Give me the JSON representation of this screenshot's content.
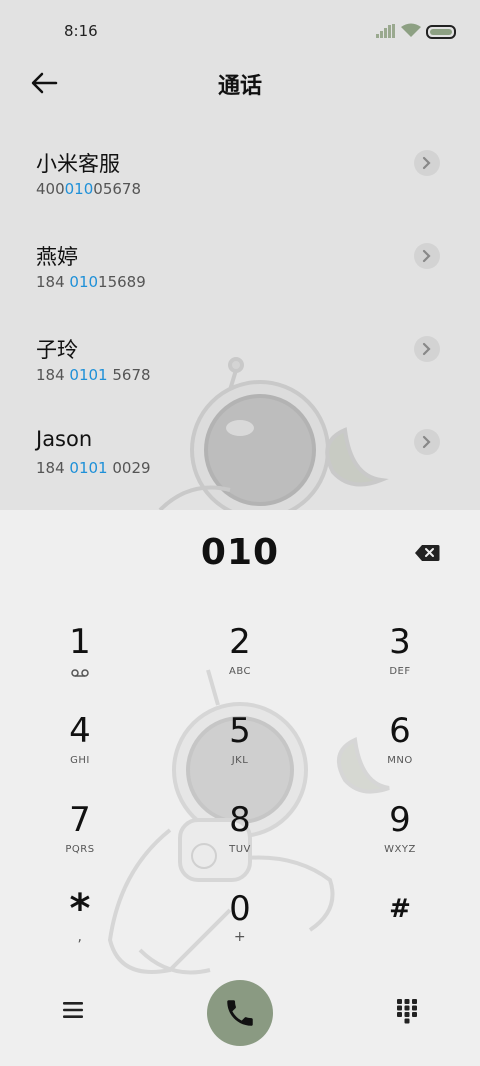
{
  "status": {
    "time": "8:16"
  },
  "header": {
    "title": "通话"
  },
  "contacts": [
    {
      "name": "小米客服",
      "num_pre": "400",
      "num_hl": "010",
      "num_post": "05678"
    },
    {
      "name": "燕婷",
      "num_pre": "184 ",
      "num_hl": "010",
      "num_post": "15689"
    },
    {
      "name": "子玲",
      "num_pre": "184 ",
      "num_hl": "0101",
      "num_post": " 5678"
    },
    {
      "name": "Jason",
      "num_pre": "184 ",
      "num_hl": "0101",
      "num_post": " 0029"
    }
  ],
  "dialer": {
    "input": "010",
    "keys": [
      {
        "digit": "1",
        "sub": ""
      },
      {
        "digit": "2",
        "sub": "ABC"
      },
      {
        "digit": "3",
        "sub": "DEF"
      },
      {
        "digit": "4",
        "sub": "GHI"
      },
      {
        "digit": "5",
        "sub": "JKL"
      },
      {
        "digit": "6",
        "sub": "MNO"
      },
      {
        "digit": "7",
        "sub": "PQRS"
      },
      {
        "digit": "8",
        "sub": "TUV"
      },
      {
        "digit": "9",
        "sub": "WXYZ"
      },
      {
        "digit": "*",
        "sub": ","
      },
      {
        "digit": "0",
        "sub": "+"
      },
      {
        "digit": "#",
        "sub": ""
      }
    ]
  },
  "icons": {
    "back": "arrow-left-icon",
    "chevron": "chevron-right-icon",
    "delete": "backspace-icon",
    "menu": "menu-icon",
    "call": "phone-icon",
    "keypad": "keypad-icon",
    "voicemail": "voicemail-icon"
  },
  "colors": {
    "highlight": "#1e90d8",
    "call_button": "#8a9a82",
    "battery_fill": "#8da083"
  }
}
